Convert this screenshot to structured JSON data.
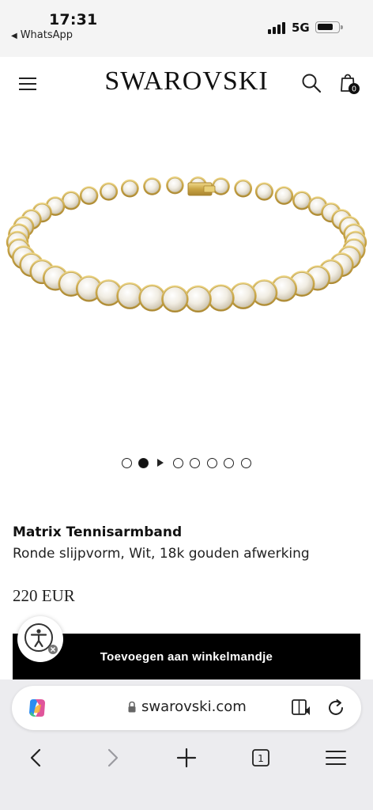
{
  "status_bar": {
    "time": "17:31",
    "back_app": "WhatsApp",
    "network": "5G"
  },
  "header": {
    "logo": "SWAROVSKI",
    "cart_count": "0"
  },
  "carousel": {
    "slide_count": 8,
    "active_index": 1,
    "has_video_slide": true
  },
  "product": {
    "title": "Matrix Tennisarmband",
    "subtitle": "Ronde slijpvorm, Wit, 18k gouden afwerking",
    "price": "220 EUR",
    "add_to_cart_label": "Toevoegen aan winkelmandje"
  },
  "browser": {
    "url": "swarovski.com",
    "tab_count": "1"
  },
  "icons": {
    "menu": "hamburger-menu-icon",
    "search": "search-icon",
    "bag": "shopping-bag-icon",
    "accessibility": "accessibility-icon",
    "copilot": "copilot-icon",
    "lock": "lock-icon",
    "reader": "reader-mode-icon",
    "reload": "reload-icon",
    "back": "back-icon",
    "forward": "forward-icon",
    "new_tab": "plus-icon",
    "tabs": "tabs-icon",
    "more_menu": "menu-icon"
  },
  "colors": {
    "button_bg": "#000000",
    "gold": "#d4b45c"
  }
}
